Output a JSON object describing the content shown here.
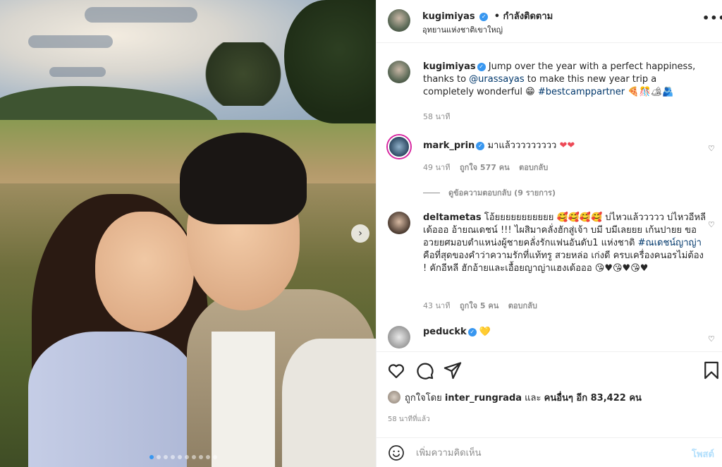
{
  "post": {
    "carousel": {
      "slide_count": 10,
      "active_index": 0,
      "next_icon": "chevron-right-icon"
    },
    "header": {
      "username": "kugimiyas",
      "follow_status": "• กำลังติดตาม",
      "location": "อุทยานแห่งชาติเขาใหญ่",
      "more_icon": "more-options-icon"
    },
    "caption": {
      "username": "kugimiyas",
      "text_1": " Jump over the year with a perfect happiness, thanks to ",
      "mention": "@urassayas",
      "text_2": " to make this new year trip a completely wonderful ",
      "emoji_1": "😁",
      "hashtag": "#bestcamppartner",
      "emoji_2": "🍕🎊🏕🫂",
      "time": "58 นาที"
    },
    "comments": [
      {
        "username": "mark_prin",
        "text": " มาแล้ววววววววว ",
        "emoji": "❤❤",
        "time": "49 นาที",
        "likes": "ถูกใจ 577 คน",
        "reply": "ตอบกลับ",
        "view_replies": "ดูข้อความตอบกลับ (9 รายการ)"
      },
      {
        "username": "deltametas",
        "text_1": " โอ้ยยยยยยยยยยย 🥰🥰🥰🥰 บ่ไหวแล้ววววว บ่ไหวอีหลีเด้อออ อ้ายณเดชน์ !!! ไผสิมาคลั่งฮักสู่เจ้า บมี บมีเลยยย เก้นปายย ขออวยยศมอบตำแหน่งผู้ชายคลั่งรักแฟนอันดับ1 แห่งชาติ ",
        "hashtag": "#ณเดชน์ญาญ่า",
        "text_2": " คือที่สุดของคำว่าความรักที่แท้ทรู สวยหล่อ เก่งดี ครบเครื่องคนอรไม่ต้อง ! คักอีหลี ฮักอ้ายและเอื้อยญาญ่าแฮงเด้อออ 😘♥😘♥😘♥",
        "time": "43 นาที",
        "likes": "ถูกใจ 5 คน",
        "reply": "ตอบกลับ"
      },
      {
        "username": "peduckk",
        "text": " ",
        "emoji": "💛"
      }
    ],
    "actions": {
      "like_icon": "heart-outline-icon",
      "comment_icon": "comment-icon",
      "share_icon": "share-icon",
      "save_icon": "bookmark-icon",
      "liked_by_prefix": "ถูกใจโดย ",
      "liked_by_user": "inter_rungrada",
      "liked_by_middle": " และ ",
      "liked_by_others": "คนอื่นๆ อีก 83,422 คน",
      "posted_time": "58 นาทีที่แล้ว"
    },
    "add_comment": {
      "placeholder": "เพิ่มความคิดเห็น",
      "post_label": "โพสต์",
      "emoji_icon": "emoji-smile-icon"
    }
  }
}
